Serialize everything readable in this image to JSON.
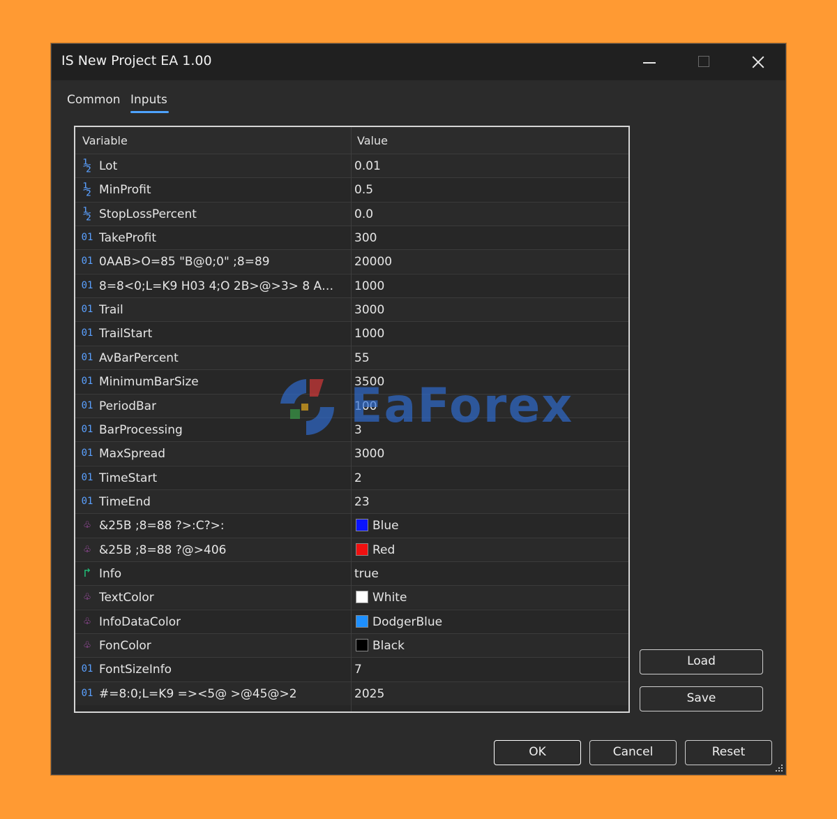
{
  "window": {
    "title": "IS New Project EA 1.00"
  },
  "tabs": [
    {
      "label": "Common",
      "active": false
    },
    {
      "label": "Inputs",
      "active": true
    }
  ],
  "grid": {
    "columns": [
      "Variable",
      "Value"
    ],
    "rows": [
      {
        "icon": "fraction-icon",
        "name": "Lot",
        "value": "0.01"
      },
      {
        "icon": "fraction-icon",
        "name": "MinProfit",
        "value": "0.5"
      },
      {
        "icon": "fraction-icon",
        "name": "StopLossPercent",
        "value": "0.0"
      },
      {
        "icon": "integer-icon",
        "name": "TakeProfit",
        "value": "300"
      },
      {
        "icon": "integer-icon",
        "name": "0AAB>O=85 \"B@0;0\" ;8=89",
        "value": "20000"
      },
      {
        "icon": "integer-icon",
        "name": "8=8<0;L=K9 H03 4;O 2B>@>3> 8 A…",
        "value": "1000"
      },
      {
        "icon": "integer-icon",
        "name": "Trail",
        "value": "3000"
      },
      {
        "icon": "integer-icon",
        "name": "TrailStart",
        "value": "1000"
      },
      {
        "icon": "integer-icon",
        "name": "AvBarPercent",
        "value": "55"
      },
      {
        "icon": "integer-icon",
        "name": "MinimumBarSize",
        "value": "3500"
      },
      {
        "icon": "integer-icon",
        "name": "PeriodBar",
        "value": "100"
      },
      {
        "icon": "integer-icon",
        "name": "BarProcessing",
        "value": "3"
      },
      {
        "icon": "integer-icon",
        "name": "MaxSpread",
        "value": "3000"
      },
      {
        "icon": "integer-icon",
        "name": "TimeStart",
        "value": "2"
      },
      {
        "icon": "integer-icon",
        "name": "TimeEnd",
        "value": "23"
      },
      {
        "icon": "color-icon",
        "name": "&25B ;8=88 ?>:C?>:",
        "value": "Blue",
        "swatch": "#0a14ff"
      },
      {
        "icon": "color-icon",
        "name": "&25B ;8=88 ?@>406",
        "value": "Red",
        "swatch": "#f01010"
      },
      {
        "icon": "bool-icon",
        "name": "Info",
        "value": "true"
      },
      {
        "icon": "color-icon",
        "name": "TextColor",
        "value": "White",
        "swatch": "#ffffff"
      },
      {
        "icon": "color-icon",
        "name": "InfoDataColor",
        "value": "DodgerBlue",
        "swatch": "#1e90ff"
      },
      {
        "icon": "color-icon",
        "name": "FonColor",
        "value": "Black",
        "swatch": "#000000"
      },
      {
        "icon": "integer-icon",
        "name": "FontSizeInfo",
        "value": "7"
      },
      {
        "icon": "integer-icon",
        "name": "#=8:0;L=K9 =><5@ >@45@>2",
        "value": "2025"
      }
    ]
  },
  "icon_glyphs": {
    "fraction-icon": "½",
    "integer-icon": "01",
    "color-icon": "♧",
    "bool-icon": "↱"
  },
  "watermark": {
    "text": "EaForex"
  },
  "buttons": {
    "load": "Load",
    "save": "Save",
    "ok": "OK",
    "cancel": "Cancel",
    "reset": "Reset"
  },
  "colors": {
    "accent": "#4ea3ff",
    "background": "#ff9a33"
  }
}
